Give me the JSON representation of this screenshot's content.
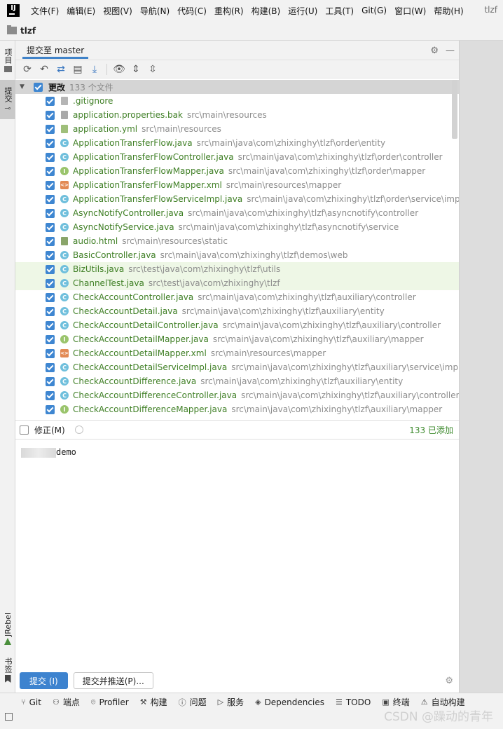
{
  "menubar": {
    "logo": "IJ",
    "items": [
      "文件(F)",
      "编辑(E)",
      "视图(V)",
      "导航(N)",
      "代码(C)",
      "重构(R)",
      "构建(B)",
      "运行(U)",
      "工具(T)",
      "Git(G)",
      "窗口(W)",
      "帮助(H)"
    ],
    "title": "tlzf"
  },
  "project": {
    "name": "tlzf"
  },
  "left_strip": {
    "project_tab": "项目",
    "commit_tab": "提交",
    "jrebel_tab": "JRebel",
    "bookmarks_tab": "书签"
  },
  "panel": {
    "tab_label": "提交至 master",
    "tree": {
      "root_label": "更改",
      "root_count": "133 个文件",
      "files": [
        {
          "name": ".gitignore",
          "path": "",
          "icon": "ignore"
        },
        {
          "name": "application.properties.bak",
          "path": "src\\main\\resources",
          "icon": "text"
        },
        {
          "name": "application.yml",
          "path": "src\\main\\resources",
          "icon": "yml"
        },
        {
          "name": "ApplicationTransferFlow.java",
          "path": "src\\main\\java\\com\\zhixinghy\\tlzf\\order\\entity",
          "icon": "class"
        },
        {
          "name": "ApplicationTransferFlowController.java",
          "path": "src\\main\\java\\com\\zhixinghy\\tlzf\\order\\controller",
          "icon": "class"
        },
        {
          "name": "ApplicationTransferFlowMapper.java",
          "path": "src\\main\\java\\com\\zhixinghy\\tlzf\\order\\mapper",
          "icon": "interface"
        },
        {
          "name": "ApplicationTransferFlowMapper.xml",
          "path": "src\\main\\resources\\mapper",
          "icon": "xml"
        },
        {
          "name": "ApplicationTransferFlowServiceImpl.java",
          "path": "src\\main\\java\\com\\zhixinghy\\tlzf\\order\\service\\impl",
          "icon": "class"
        },
        {
          "name": "AsyncNotifyController.java",
          "path": "src\\main\\java\\com\\zhixinghy\\tlzf\\asyncnotify\\controller",
          "icon": "class"
        },
        {
          "name": "AsyncNotifyService.java",
          "path": "src\\main\\java\\com\\zhixinghy\\tlzf\\asyncnotify\\service",
          "icon": "class"
        },
        {
          "name": "audio.html",
          "path": "src\\main\\resources\\static",
          "icon": "html"
        },
        {
          "name": "BasicController.java",
          "path": "src\\main\\java\\com\\zhixinghy\\tlzf\\demos\\web",
          "icon": "class"
        },
        {
          "name": "BizUtils.java",
          "path": "src\\test\\java\\com\\zhixinghy\\tlzf\\utils",
          "icon": "class",
          "highlight": true
        },
        {
          "name": "ChannelTest.java",
          "path": "src\\test\\java\\com\\zhixinghy\\tlzf",
          "icon": "class",
          "highlight": true
        },
        {
          "name": "CheckAccountController.java",
          "path": "src\\main\\java\\com\\zhixinghy\\tlzf\\auxiliary\\controller",
          "icon": "class"
        },
        {
          "name": "CheckAccountDetail.java",
          "path": "src\\main\\java\\com\\zhixinghy\\tlzf\\auxiliary\\entity",
          "icon": "class"
        },
        {
          "name": "CheckAccountDetailController.java",
          "path": "src\\main\\java\\com\\zhixinghy\\tlzf\\auxiliary\\controller",
          "icon": "class"
        },
        {
          "name": "CheckAccountDetailMapper.java",
          "path": "src\\main\\java\\com\\zhixinghy\\tlzf\\auxiliary\\mapper",
          "icon": "interface"
        },
        {
          "name": "CheckAccountDetailMapper.xml",
          "path": "src\\main\\resources\\mapper",
          "icon": "xml"
        },
        {
          "name": "CheckAccountDetailServiceImpl.java",
          "path": "src\\main\\java\\com\\zhixinghy\\tlzf\\auxiliary\\service\\impl",
          "icon": "class"
        },
        {
          "name": "CheckAccountDifference.java",
          "path": "src\\main\\java\\com\\zhixinghy\\tlzf\\auxiliary\\entity",
          "icon": "class"
        },
        {
          "name": "CheckAccountDifferenceController.java",
          "path": "src\\main\\java\\com\\zhixinghy\\tlzf\\auxiliary\\controller",
          "icon": "class"
        },
        {
          "name": "CheckAccountDifferenceMapper.java",
          "path": "src\\main\\java\\com\\zhixinghy\\tlzf\\auxiliary\\mapper",
          "icon": "interface"
        }
      ]
    },
    "amend_label": "修正(M)",
    "added_status": "133 已添加",
    "commit_message": "demo",
    "commit_button": "提交 (I)",
    "commit_push_button": "提交并推送(P)..."
  },
  "statusbar": {
    "items": [
      {
        "label": "Git",
        "icon": "git-branch-icon"
      },
      {
        "label": "端点",
        "icon": "endpoints-icon"
      },
      {
        "label": "Profiler",
        "icon": "profiler-icon"
      },
      {
        "label": "构建",
        "icon": "hammer-icon"
      },
      {
        "label": "问题",
        "icon": "problems-icon"
      },
      {
        "label": "服务",
        "icon": "services-icon"
      },
      {
        "label": "Dependencies",
        "icon": "dependencies-icon"
      },
      {
        "label": "TODO",
        "icon": "todo-icon"
      },
      {
        "label": "终端",
        "icon": "terminal-icon"
      },
      {
        "label": "自动构建",
        "icon": "warning-icon"
      }
    ]
  },
  "watermark": "CSDN @躁动的青年"
}
